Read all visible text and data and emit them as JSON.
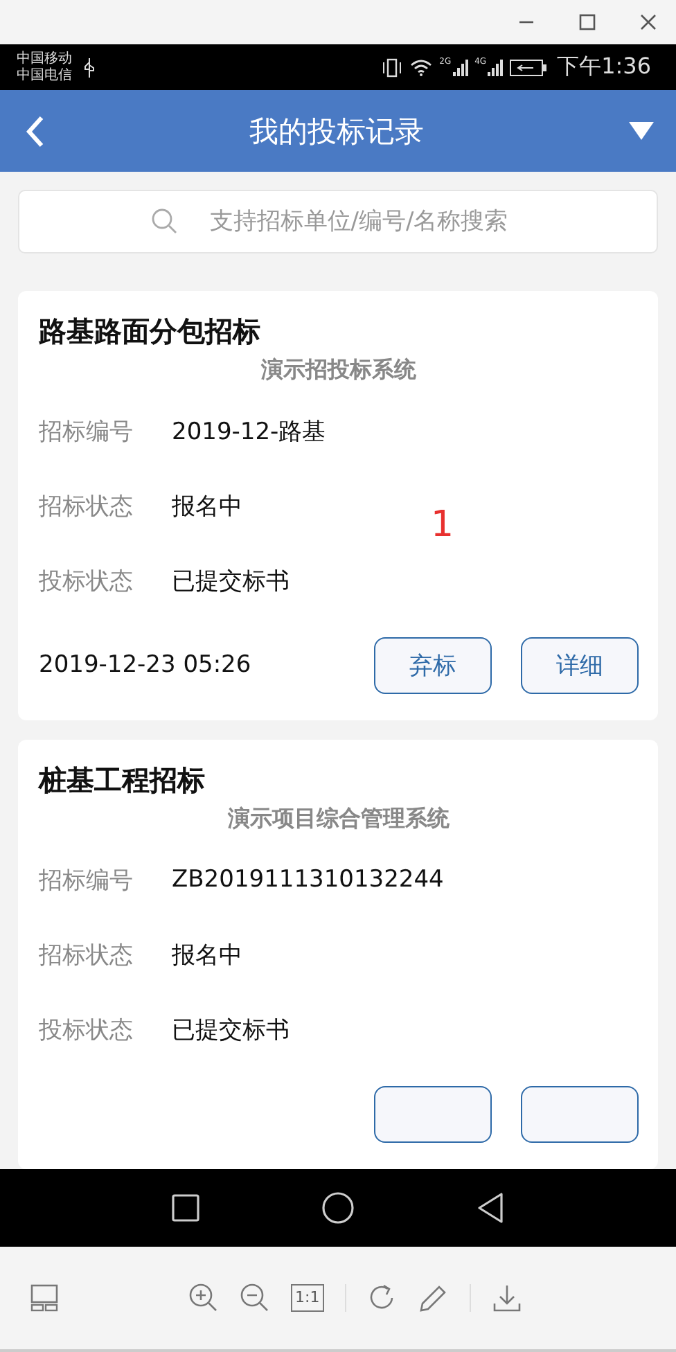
{
  "status_bar": {
    "carriers": [
      "中国移动",
      "中国电信"
    ],
    "network_labels": [
      "2G",
      "4G"
    ],
    "time": "下午1:36"
  },
  "header": {
    "title": "我的投标记录"
  },
  "search": {
    "placeholder": "支持招标单位/编号/名称搜索"
  },
  "cards": [
    {
      "title": "路基路面分包招标",
      "system": "演示招投标系统",
      "fields": [
        {
          "label": "招标编号",
          "value": "2019-12-路基"
        },
        {
          "label": "招标状态",
          "value": "报名中"
        },
        {
          "label": "投标状态",
          "value": "已提交标书"
        }
      ],
      "date": "2019-12-23 05:26",
      "actions": [
        {
          "kind": "outline",
          "label": "弃标"
        },
        {
          "kind": "outline",
          "label": "详细"
        }
      ]
    },
    {
      "title": "桩基工程招标",
      "system": "演示项目综合管理系统",
      "fields": [
        {
          "label": "招标编号",
          "value": "ZB2019111310132244"
        },
        {
          "label": "招标状态",
          "value": "报名中"
        },
        {
          "label": "投标状态",
          "value": "已提交标书"
        }
      ],
      "actions": [
        {
          "kind": "outline"
        },
        {
          "kind": "outline"
        }
      ]
    }
  ],
  "annotation": {
    "text": "1",
    "color": "#e8302e"
  },
  "viewer_toolbar": {
    "actual_size_label": "1:1"
  }
}
